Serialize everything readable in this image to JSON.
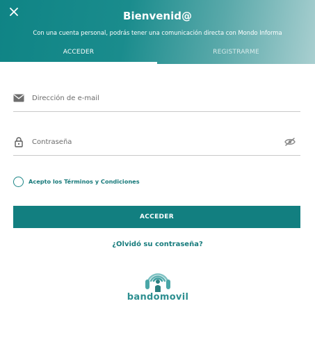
{
  "header": {
    "title": "Bienvenid@",
    "subtitle": "Con una cuenta personal, podrás tener una comunicación directa con Mondo Informa",
    "close_icon": "close-icon"
  },
  "tabs": [
    {
      "label": "ACCEDER",
      "active": true
    },
    {
      "label": "REGISTRARME",
      "active": false
    }
  ],
  "form": {
    "email": {
      "placeholder": "Dirección de e-mail",
      "value": "",
      "icon": "mail-icon"
    },
    "password": {
      "placeholder": "Contraseña",
      "value": "",
      "icon": "lock-icon",
      "toggle_icon": "eye-off-icon"
    },
    "terms_label": "Acepto los Términos y Condiciones",
    "terms_checked": false,
    "submit_label": "ACCEDER",
    "forgot_label": "¿Olvidó su contraseña?"
  },
  "brand": {
    "logo_text": "bandomovil",
    "logo_text_part1": "bando",
    "logo_text_part2": "movil"
  },
  "colors": {
    "primary": "#127f80",
    "header_start": "#0f8485",
    "header_end": "#a9cfd0"
  }
}
